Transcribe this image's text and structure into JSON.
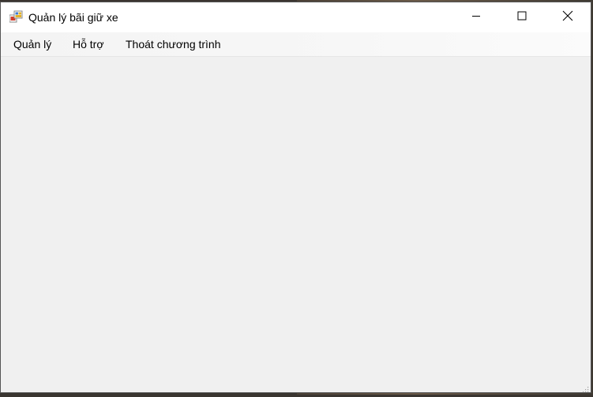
{
  "window": {
    "title": "Quản lý bãi giữ xe",
    "icon": "winforms-app-icon",
    "controls": {
      "minimize_icon": "minimize-icon",
      "maximize_icon": "maximize-icon",
      "close_icon": "close-icon"
    }
  },
  "menu": {
    "items": [
      {
        "label": "Quản lý"
      },
      {
        "label": "Hỗ trợ"
      },
      {
        "label": "Thoát chương trình"
      }
    ]
  },
  "colors": {
    "titlebar": "#ffffff",
    "client_background": "#f0f0f0",
    "text": "#000000"
  }
}
